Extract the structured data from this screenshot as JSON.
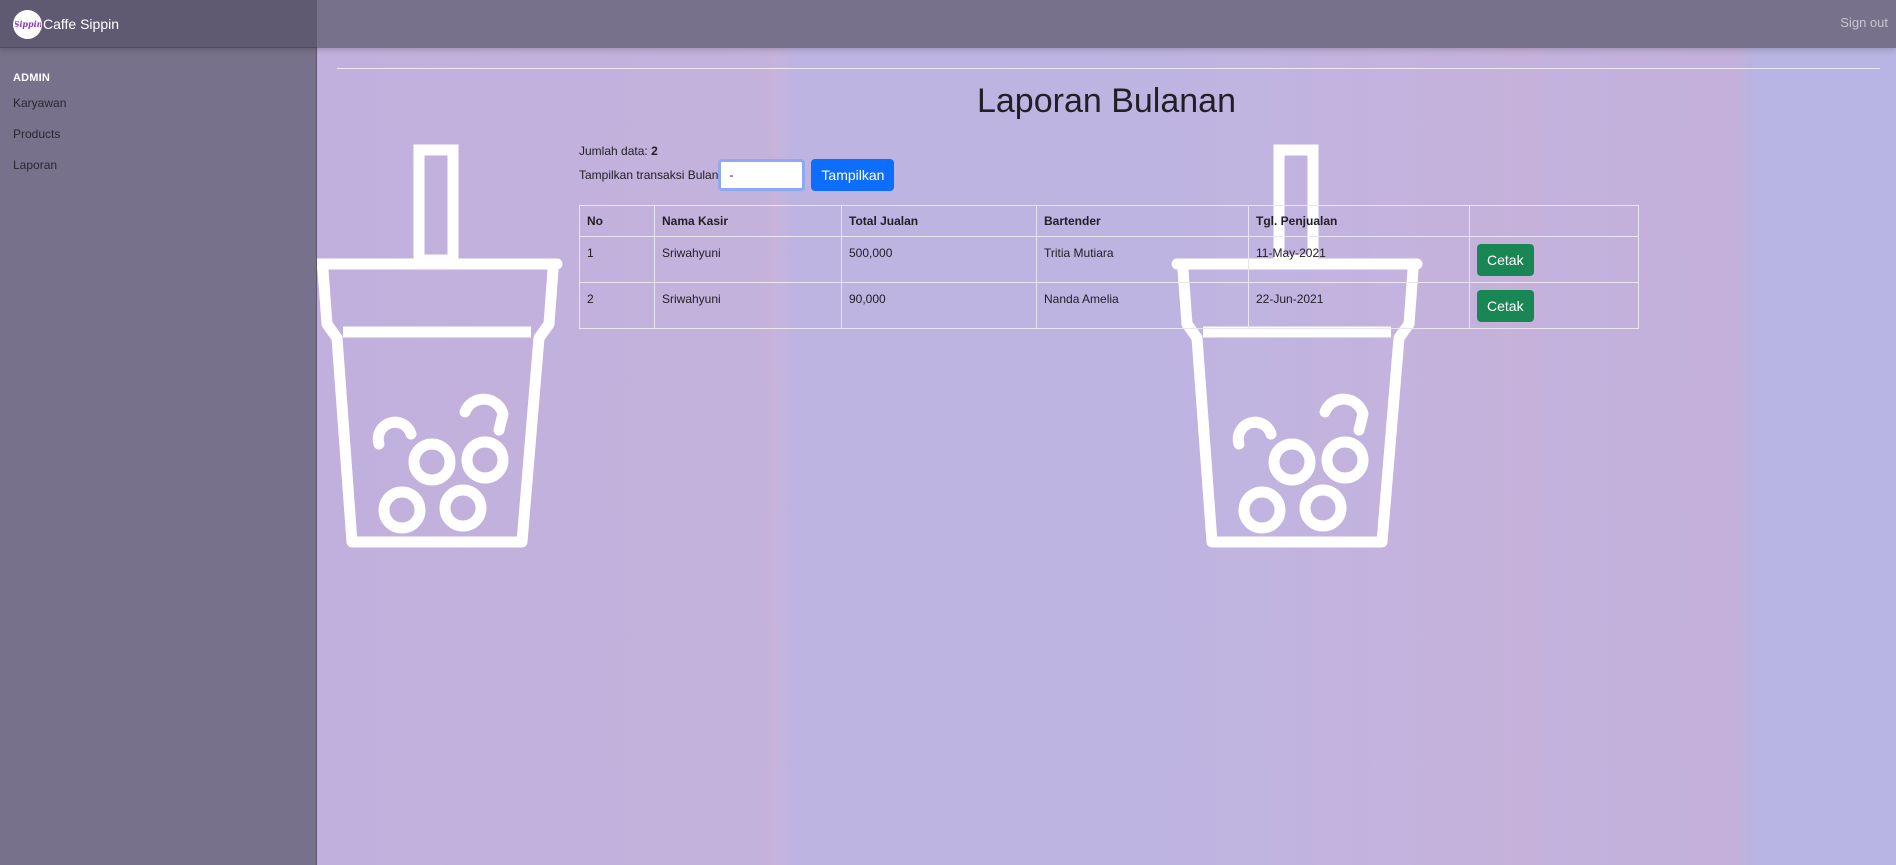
{
  "app": {
    "brand_name": "Caffe Sippin",
    "logo_text": "Sippin",
    "signout_label": "Sign out"
  },
  "sidebar": {
    "heading": "ADMIN",
    "items": [
      {
        "label": "Karyawan"
      },
      {
        "label": "Products"
      },
      {
        "label": "Laporan"
      }
    ]
  },
  "main": {
    "title": "Laporan Bulanan",
    "count_label": "Jumlah data:",
    "count_value": "2",
    "filter_label": "Tampilkan transaksi Bulan",
    "month_value": "-",
    "show_button": "Tampilkan",
    "table": {
      "headers": [
        "No",
        "Nama Kasir",
        "Total Jualan",
        "Bartender",
        "Tgl. Penjualan",
        ""
      ],
      "rows": [
        {
          "no": "1",
          "cashier": "Sriwahyuni",
          "total": "500,000",
          "bartender": "Tritia Mutiara",
          "date": "11-May-2021",
          "action": "Cetak"
        },
        {
          "no": "2",
          "cashier": "Sriwahyuni",
          "total": "90,000",
          "bartender": "Nanda Amelia",
          "date": "22-Jun-2021",
          "action": "Cetak"
        }
      ]
    }
  },
  "colors": {
    "primary_button": "#0d6efd",
    "success_button": "#198754",
    "sidebar_bg": "#77718b",
    "background": "#c0b2dc"
  },
  "decorations": {
    "watermark_icon": "bubble-tea-cup-icon"
  }
}
